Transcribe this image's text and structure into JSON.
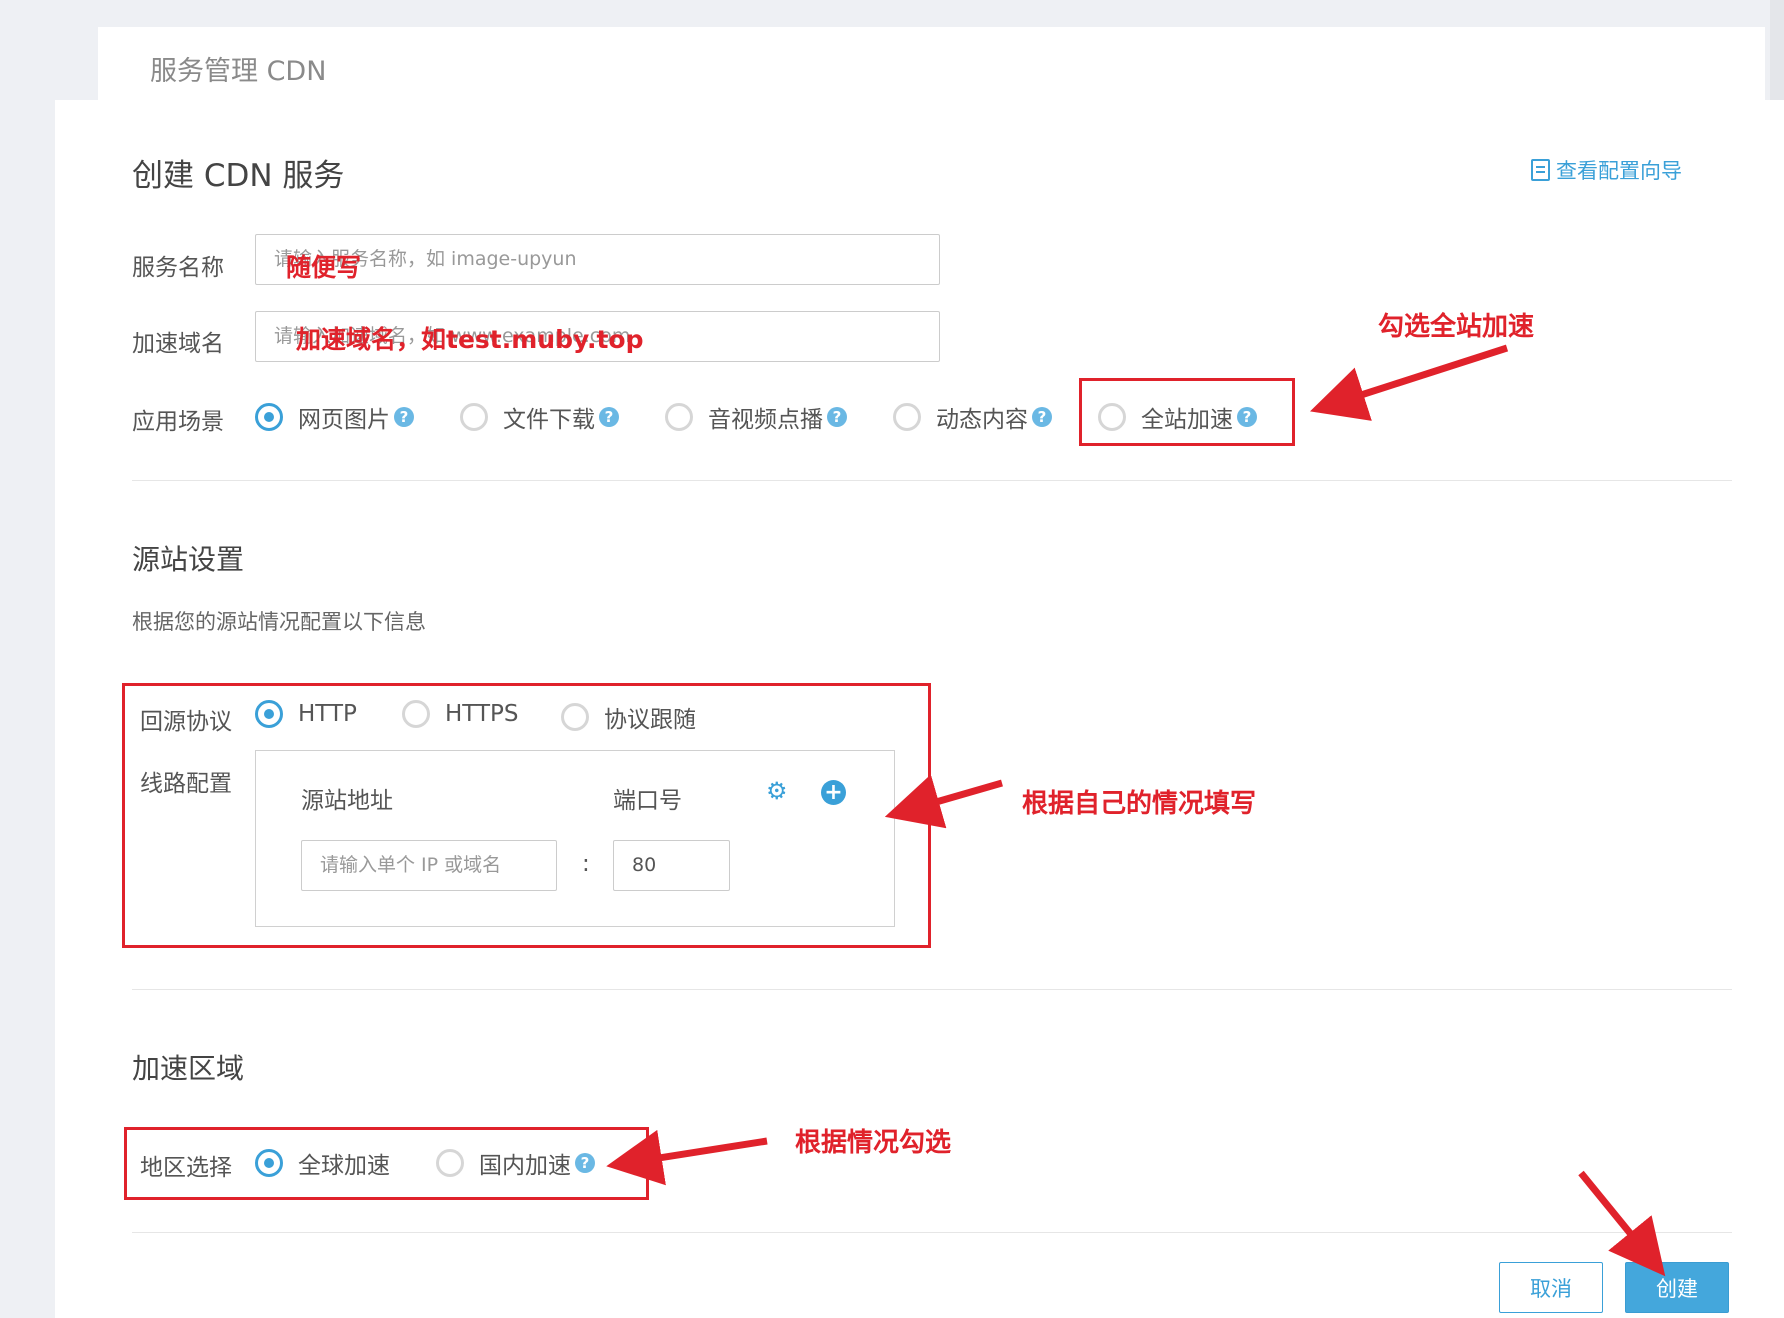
{
  "header": {
    "breadcrumb": "服务管理 CDN"
  },
  "page": {
    "title": "创建 CDN 服务",
    "guide_link": "查看配置向导"
  },
  "form": {
    "service_name": {
      "label": "服务名称",
      "placeholder": "请输入服务名称，如 image-upyun",
      "visible_placeholder": "请输入服务名称，如 image-upyun"
    },
    "domain": {
      "label": "加速域名",
      "placeholder": "请输入加速域名，如 www.example.com",
      "visible_placeholder": "请输入加速域名，如 www.example.com"
    },
    "scenario": {
      "label": "应用场景",
      "options": [
        {
          "label": "网页图片",
          "selected": true,
          "help": true
        },
        {
          "label": "文件下载",
          "selected": false,
          "help": true
        },
        {
          "label": "音视频点播",
          "selected": false,
          "help": true
        },
        {
          "label": "动态内容",
          "selected": false,
          "help": true
        },
        {
          "label": "全站加速",
          "selected": false,
          "help": true
        }
      ]
    }
  },
  "origin": {
    "section_title": "源站设置",
    "description": "根据您的源站情况配置以下信息",
    "protocol": {
      "label": "回源协议",
      "options": [
        {
          "label": "HTTP",
          "selected": true
        },
        {
          "label": "HTTPS",
          "selected": false
        },
        {
          "label": "协议跟随",
          "selected": false
        }
      ]
    },
    "route": {
      "label": "线路配置",
      "address_header": "源站地址",
      "port_header": "端口号",
      "address_placeholder": "请输入单个 IP 或域名",
      "separator": ":",
      "port_value": "80",
      "gear_icon": "gear-icon",
      "add_icon": "plus-circle-icon"
    }
  },
  "region": {
    "section_title": "加速区域",
    "label": "地区选择",
    "options": [
      {
        "label": "全球加速",
        "selected": true,
        "help": false
      },
      {
        "label": "国内加速",
        "selected": false,
        "help": true
      }
    ]
  },
  "actions": {
    "cancel": "取消",
    "create": "创建"
  },
  "annotations": {
    "service_name_note": "随便写",
    "domain_note": "加速域名，如test.muby.top",
    "full_site_note": "勾选全站加速",
    "origin_note": "根据自己的情况填写",
    "region_note": "根据情况勾选"
  },
  "colors": {
    "accent": "#3aa0d8",
    "annotation_red": "#e0222b",
    "help_icon": "#6ab8e4"
  }
}
